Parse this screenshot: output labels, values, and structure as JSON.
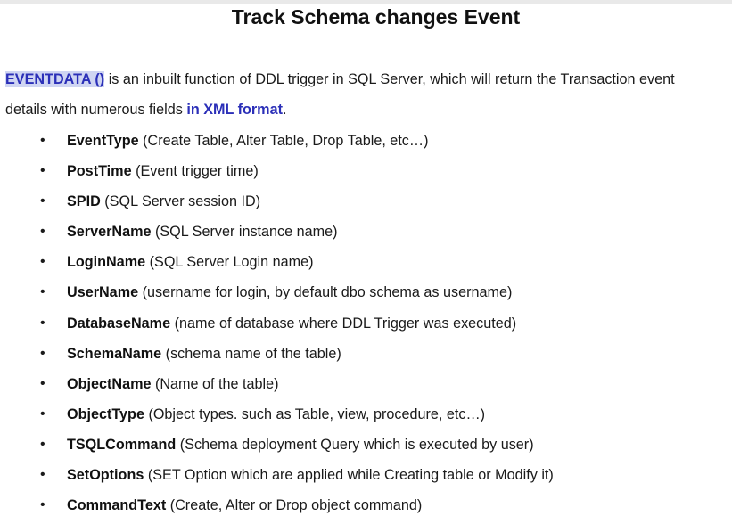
{
  "page": {
    "title": "Track Schema changes Event"
  },
  "intro": {
    "keyword": "EVENTDATA ()",
    "text_1": " is an inbuilt function of DDL trigger in SQL Server, which will return the Transaction event",
    "text_2": "details with numerous fields ",
    "highlight": "in XML format",
    "text_3": "."
  },
  "fields": [
    {
      "name": "EventType",
      "desc": " (Create Table, Alter Table, Drop Table, etc…)"
    },
    {
      "name": "PostTime",
      "desc": " (Event trigger time)"
    },
    {
      "name": "SPID",
      "desc": " (SQL Server session ID)"
    },
    {
      "name": "ServerName",
      "desc": " (SQL Server instance name)"
    },
    {
      "name": "LoginName",
      "desc": " (SQL Server Login name)"
    },
    {
      "name": "UserName",
      "desc": " (username for login, by default dbo schema as username)"
    },
    {
      "name": "DatabaseName",
      "desc": " (name of database where DDL Trigger was executed)"
    },
    {
      "name": "SchemaName",
      "desc": " (schema name of the table)"
    },
    {
      "name": "ObjectName",
      "desc": " (Name of the table)"
    },
    {
      "name": "ObjectType",
      "desc": " (Object types. such as Table, view, procedure, etc…)"
    },
    {
      "name": "TSQLCommand",
      "desc": " (Schema deployment Query which is executed by user)"
    },
    {
      "name": "SetOptions",
      "desc": " (SET Option which are applied while Creating table or Modify it)"
    },
    {
      "name": "CommandText",
      "desc": " (Create, Alter or Drop object command)"
    }
  ],
  "colors": {
    "keyword": "#2b2fb8",
    "keyword_highlight_bg": "#cfd5f2",
    "text": "#1a1a1a"
  }
}
